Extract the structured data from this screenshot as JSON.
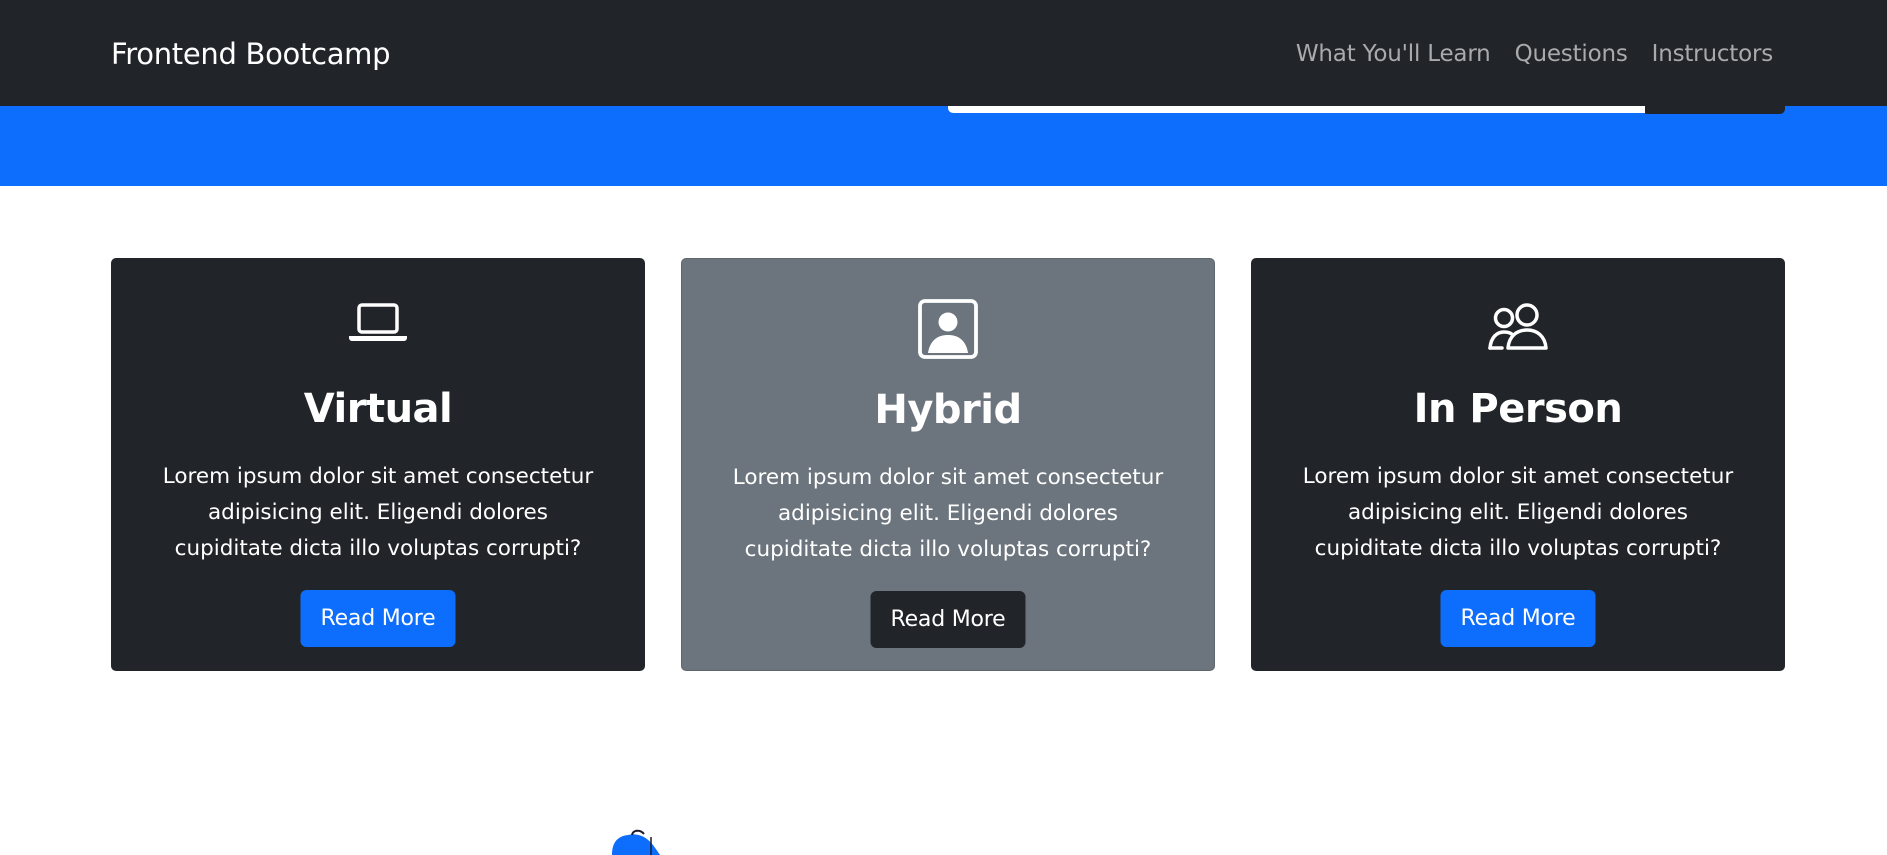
{
  "navbar": {
    "brand": "Frontend Bootcamp",
    "links": [
      "What You'll Learn",
      "Questions",
      "Instructors"
    ]
  },
  "cards": [
    {
      "icon": "laptop-icon",
      "title": "Virtual",
      "text": "Lorem ipsum dolor sit amet consectetur adipisicing elit. Eligendi dolores cupiditate dicta illo voluptas corrupti?",
      "button": "Read More"
    },
    {
      "icon": "person-square-icon",
      "title": "Hybrid",
      "text": "Lorem ipsum dolor sit amet consectetur adipisicing elit. Eligendi dolores cupiditate dicta illo voluptas corrupti?",
      "button": "Read More"
    },
    {
      "icon": "people-icon",
      "title": "In Person",
      "text": "Lorem ipsum dolor sit amet consectetur adipisicing elit. Eligendi dolores cupiditate dicta illo voluptas corrupti?",
      "button": "Read More"
    }
  ],
  "colors": {
    "primary": "#0d6efd",
    "dark": "#212529",
    "secondary": "#6c757d",
    "nav_link": "#a9aaab"
  }
}
